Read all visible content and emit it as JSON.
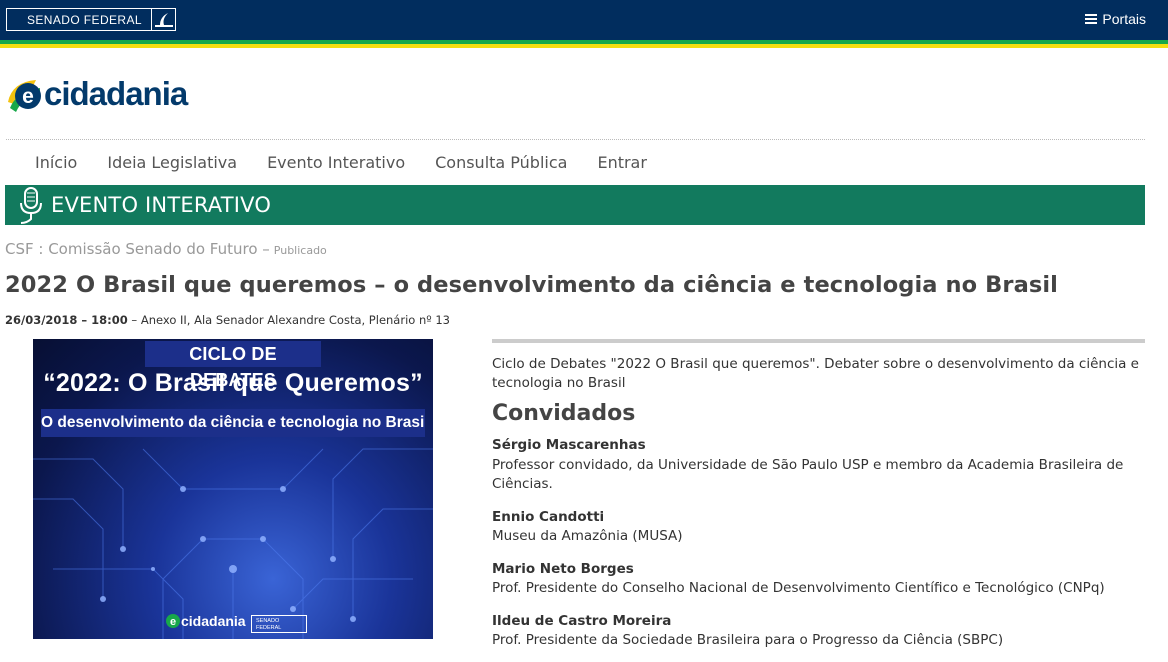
{
  "header": {
    "senado_label": "SENADO FEDERAL",
    "portais_label": "Portais"
  },
  "logo": {
    "prefix": "e",
    "text": "cidadania"
  },
  "nav": {
    "items": [
      {
        "label": "Início"
      },
      {
        "label": "Ideia Legislativa"
      },
      {
        "label": "Evento Interativo"
      },
      {
        "label": "Consulta Pública"
      },
      {
        "label": "Entrar"
      }
    ]
  },
  "banner": {
    "title": "EVENTO INTERATIVO"
  },
  "event": {
    "committee": "CSF : Comissão Senado do Futuro –",
    "status": "Publicado",
    "title": "2022 O Brasil que queremos – o desenvolvimento da ciência e tecnologia no Brasil",
    "datetime": "26/03/2018 – 18:00",
    "location": " – Anexo II, Ala Senador Alexandre Costa, Plenário nº 13",
    "description": "Ciclo de Debates \"2022 O Brasil que queremos\". Debater sobre o desenvolvimento da ciência e tecnologia no Brasil"
  },
  "poster": {
    "kicker": "CICLO DE DEBATES",
    "headline": "“2022: O Brasil que Queremos”",
    "subtitle": "O desenvolvimento da ciência e tecnologia no Brasil",
    "logo_prefix": "e",
    "logo_text": "cidadania",
    "senado_line1": "SENADO",
    "senado_line2": "FEDERAL"
  },
  "guests": {
    "section_title": "Convidados",
    "items": [
      {
        "name": "Sérgio Mascarenhas",
        "role": "Professor convidado, da Universidade de São Paulo USP e membro da Academia Brasileira de Ciências."
      },
      {
        "name": "Ennio Candotti",
        "role": "Museu da Amazônia (MUSA)"
      },
      {
        "name": "Mario Neto Borges",
        "role": "Prof. Presidente do Conselho Nacional de Desenvolvimento Científico e Tecnológico (CNPq)"
      },
      {
        "name": "Ildeu de Castro Moreira",
        "role": "Prof. Presidente da Sociedade Brasileira para o Progresso da Ciência (SBPC)"
      }
    ]
  },
  "colors": {
    "topbar": "#012d5e",
    "stripe_green": "#18a84a",
    "stripe_yellow": "#f4de10",
    "banner": "#127a5e",
    "logo_blue": "#033a6b"
  },
  "icons": {
    "menu": "hamburger-icon",
    "banner": "microphone-icon",
    "logo": "e-cidadania-logo"
  }
}
